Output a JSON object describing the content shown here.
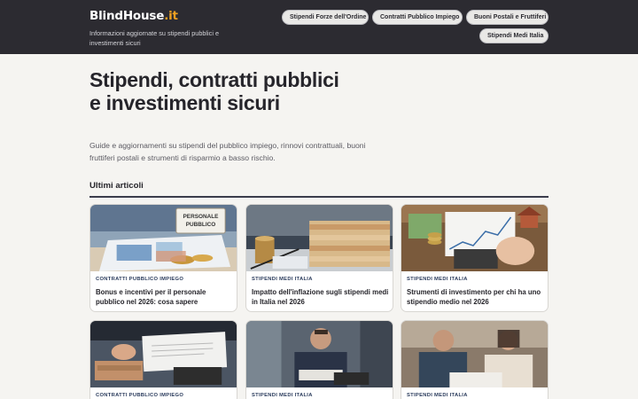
{
  "header": {
    "brand_main": "BlindHouse",
    "brand_tld": ".it",
    "tagline": "Informazioni aggiornate su stipendi pubblici e investimenti sicuri",
    "nav": [
      {
        "label": "Stipendi Forze dell'Ordine"
      },
      {
        "label": "Contratti Pubblico Impiego"
      },
      {
        "label": "Buoni Postali e Fruttiferi"
      },
      {
        "label": "Stipendi Medi Italia"
      }
    ]
  },
  "hero": {
    "title": "Stipendi, contratti pubblici e investimenti sicuri",
    "subtitle": "Guide e aggiornamenti su stipendi del pubblico impiego, rinnovi contrattuali, buoni fruttiferi postali e strumenti di risparmio a basso rischio."
  },
  "section": {
    "title": "Ultimi articoli"
  },
  "articles": [
    {
      "category": "CONTRATTI PUBBLICO IMPIEGO",
      "title": "Bonus e incentivi per il personale pubblico nel 2026: cosa sapere",
      "image_text": "PERSONALE PUBBLICO"
    },
    {
      "category": "STIPENDI MEDI ITALIA",
      "title": "Impatto dell'inflazione sugli stipendi medi in Italia nel 2026"
    },
    {
      "category": "STIPENDI MEDI ITALIA",
      "title": "Strumenti di investimento per chi ha uno stipendio medio nel 2026"
    },
    {
      "category": "CONTRATTI PUBBLICO IMPIEGO",
      "title": ""
    },
    {
      "category": "STIPENDI MEDI ITALIA",
      "title": ""
    },
    {
      "category": "STIPENDI MEDI ITALIA",
      "title": ""
    }
  ]
}
